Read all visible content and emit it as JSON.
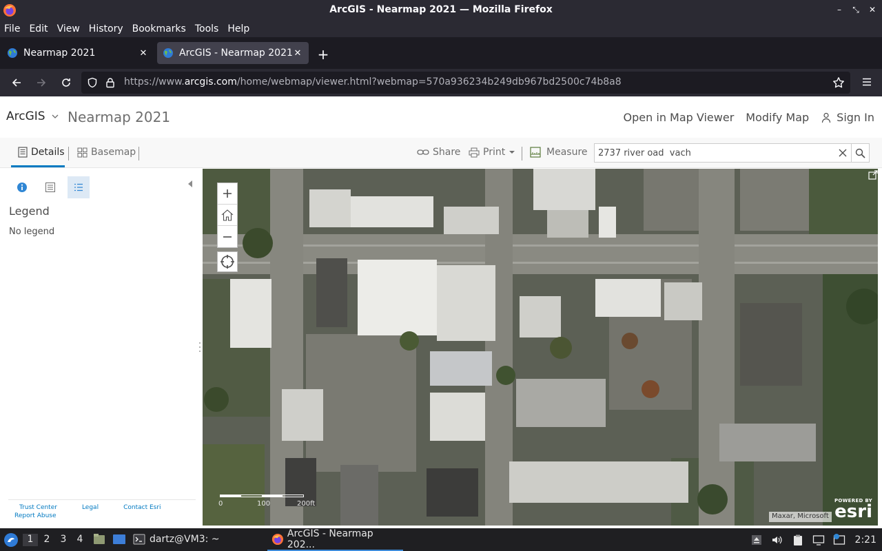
{
  "window": {
    "title": "ArcGIS - Nearmap 2021 — Mozilla Firefox"
  },
  "menu": [
    "File",
    "Edit",
    "View",
    "History",
    "Bookmarks",
    "Tools",
    "Help"
  ],
  "tabs": [
    {
      "label": "Nearmap 2021",
      "active": false
    },
    {
      "label": "ArcGIS - Nearmap 2021",
      "active": true
    }
  ],
  "url": {
    "prefix": "https://www.",
    "host": "arcgis.com",
    "path": "/home/webmap/viewer.html?webmap=570a936234b249db967bd2500c74b8a8"
  },
  "header": {
    "brand": "ArcGIS",
    "map_title": "Nearmap 2021",
    "open_viewer": "Open in Map Viewer",
    "modify_map": "Modify Map",
    "sign_in": "Sign In"
  },
  "toolbar": {
    "details": "Details",
    "basemap": "Basemap",
    "share": "Share",
    "print": "Print",
    "measure": "Measure",
    "search_value": "2737 river oad  vach"
  },
  "panel": {
    "legend_title": "Legend",
    "legend_empty": "No legend",
    "footer": {
      "trust": "Trust Center",
      "legal": "Legal",
      "contact": "Contact Esri",
      "abuse": "Report Abuse"
    }
  },
  "map": {
    "scale_labels": [
      "0",
      "100",
      "200ft"
    ],
    "attribution": "Maxar, Microsoft",
    "powered_by": "POWERED BY",
    "esri": "esri"
  },
  "taskbar": {
    "workspaces": [
      "1",
      "2",
      "3",
      "4"
    ],
    "terminal": "dartz@VM3: ~",
    "firefox": "ArcGIS - Nearmap 202...",
    "clock": "2:21"
  },
  "colors": {
    "accent": "#0079c1",
    "chrome": "#2b2a33",
    "tabbar": "#1c1b22"
  }
}
